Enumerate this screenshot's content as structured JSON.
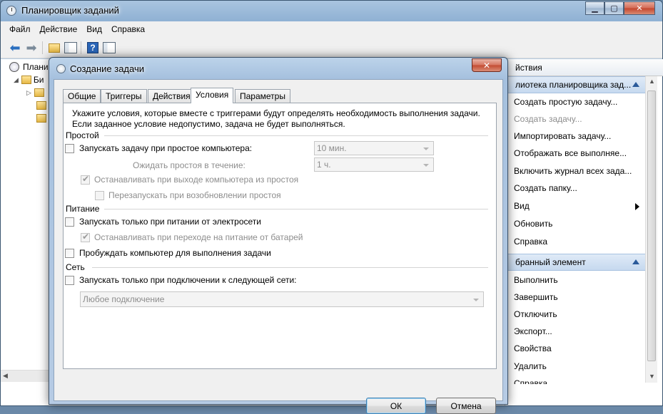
{
  "main": {
    "title": "Планировщик заданий",
    "menu": [
      "Файл",
      "Действие",
      "Вид",
      "Справка"
    ],
    "tree": {
      "root_label": "Планировщик заданий (Локальный)",
      "root_visible": "Плани",
      "child_visible": "Би"
    },
    "actions": {
      "header": "Действия",
      "header_visible": "йствия",
      "section1": "Библиотека планировщика заданий",
      "section1_visible": "лиотека планировщика зад...",
      "section1_items": [
        {
          "label": "Создать простую задачу...",
          "disabled": false
        },
        {
          "label": "Создать задачу...",
          "disabled": true
        },
        {
          "label": "Импортировать задачу...",
          "disabled": false
        },
        {
          "label": "Отображать все выполняе...",
          "disabled": false
        },
        {
          "label": "Включить журнал всех зада...",
          "disabled": false
        },
        {
          "label": "Создать папку...",
          "disabled": false
        },
        {
          "label": "Вид",
          "disabled": false
        },
        {
          "label": "Обновить",
          "disabled": false
        },
        {
          "label": "Справка",
          "disabled": false
        }
      ],
      "section2": "Выбранный элемент",
      "section2_visible": "бранный элемент",
      "section2_items": [
        "Выполнить",
        "Завершить",
        "Отключить",
        "Экспорт...",
        "Свойства",
        "Удалить",
        "Справка"
      ]
    }
  },
  "dialog": {
    "title": "Создание задачи",
    "close_glyph": "✕",
    "tabs": [
      "Общие",
      "Триггеры",
      "Действия",
      "Условия",
      "Параметры"
    ],
    "active_tab": "Условия",
    "description": [
      "Укажите условия, которые вместе с триггерами будут определять необходимость выполнения задачи.",
      "Если заданное условие недопустимо, задача не будет выполняться."
    ],
    "idle": {
      "group": "Простой",
      "start_on_idle": {
        "label": "Запускать задачу при простое компьютера:",
        "checked": false
      },
      "idle_duration": "10 мин.",
      "wait_label": "Ожидать простоя в течение:",
      "wait_duration": "1 ч.",
      "stop_on_idle_end": {
        "label": "Останавливать при выходе компьютера из простоя",
        "checked": true
      },
      "restart_on_idle": {
        "label": "Перезапускать при возобновлении простоя",
        "checked": false
      }
    },
    "power": {
      "group": "Питание",
      "ac_only": {
        "label": "Запускать только при питании от электросети",
        "checked": false
      },
      "stop_on_battery": {
        "label": "Останавливать при переходе на питание от батарей",
        "checked": true
      },
      "wake": {
        "label": "Пробуждать компьютер для выполнения задачи",
        "checked": false
      }
    },
    "network": {
      "group": "Сеть",
      "network_only": {
        "label": "Запускать только при подключении к следующей сети:",
        "checked": false
      },
      "connection": "Любое подключение"
    },
    "ok": "ОК",
    "cancel": "Отмена"
  }
}
